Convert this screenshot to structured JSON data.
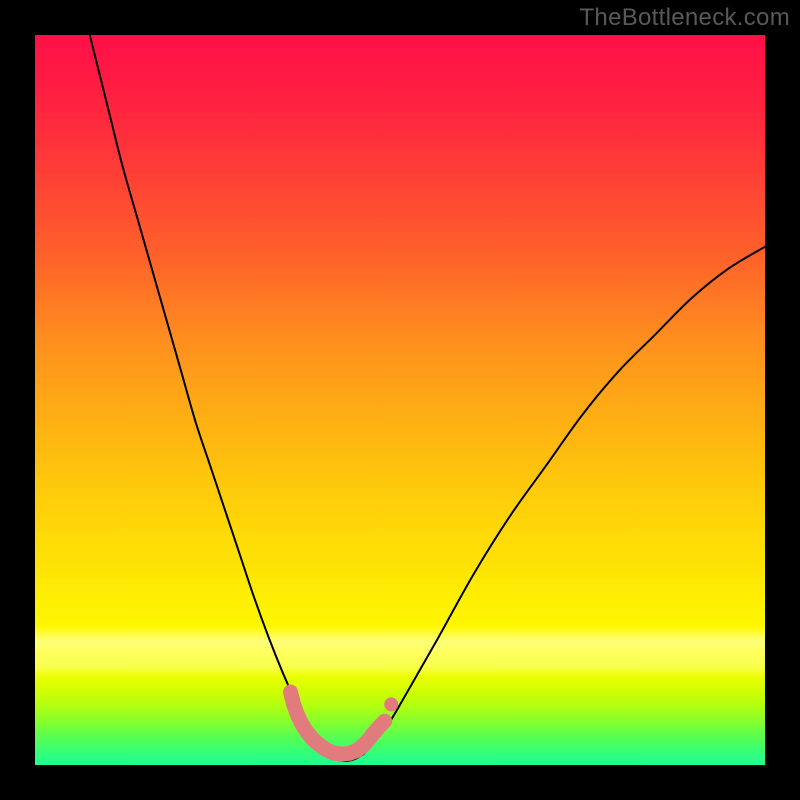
{
  "watermark": "TheBottleneck.com",
  "colors": {
    "background": "#000000",
    "curve": "#000000",
    "marker": "#e27b7d",
    "gradient_top": "#fe1047",
    "gradient_bottom": "#1efe93"
  },
  "chart_data": {
    "type": "line",
    "title": "",
    "xlabel": "",
    "ylabel": "",
    "xlim": [
      0,
      100
    ],
    "ylim": [
      0,
      100
    ],
    "y_orientation": "top_is_high_bottom_is_low",
    "notes": "Two curved lines forming a V/check-mark shape; bottom near x≈38-45 at y≈0-2; markers cluster near the valley. No tick labels visible.",
    "series": [
      {
        "name": "left-branch",
        "type": "curve",
        "x": [
          7.5,
          10,
          12,
          14,
          16,
          18,
          20,
          22,
          24,
          26,
          28,
          30,
          32,
          34,
          36,
          38,
          40
        ],
        "y": [
          100,
          90,
          82,
          75,
          68,
          61,
          54,
          47,
          41,
          35,
          29,
          23,
          17.5,
          12.5,
          8,
          4,
          1.5
        ]
      },
      {
        "name": "right-branch",
        "type": "curve",
        "x": [
          45,
          48,
          51,
          55,
          60,
          65,
          70,
          75,
          80,
          85,
          90,
          95,
          100
        ],
        "y": [
          1.5,
          5,
          10,
          17,
          26,
          34,
          41,
          48,
          54,
          59,
          64,
          68,
          71
        ]
      },
      {
        "name": "valley-floor",
        "type": "curve",
        "x": [
          40,
          41,
          42,
          43,
          44,
          45
        ],
        "y": [
          1.5,
          0.9,
          0.6,
          0.6,
          0.9,
          1.5
        ]
      },
      {
        "name": "marker-cluster",
        "type": "markers",
        "x": [
          35.0,
          35.4,
          35.9,
          36.5,
          37.2,
          38.0,
          38.9,
          39.9,
          41.0,
          42.1,
          43.1,
          44.1,
          45.0,
          45.8,
          46.5,
          47.2,
          47.9
        ],
        "y": [
          10.0,
          8.4,
          7.0,
          5.7,
          4.6,
          3.6,
          2.8,
          2.1,
          1.6,
          1.5,
          1.6,
          2.0,
          2.7,
          3.6,
          4.5,
          5.3,
          6.0
        ]
      }
    ],
    "gradient_background": {
      "description": "Vertical rainbow gradient mapping y (100→0) to color (red→green)",
      "stops_pct_to_color": [
        [
          0,
          "#fe1047"
        ],
        [
          12,
          "#fe2a3e"
        ],
        [
          24,
          "#fe4e31"
        ],
        [
          36,
          "#fe7824"
        ],
        [
          48,
          "#fea217"
        ],
        [
          60,
          "#fec40d"
        ],
        [
          72.5,
          "#fee205"
        ],
        [
          84,
          "#fefe00"
        ],
        [
          90,
          "#cffe03"
        ],
        [
          96,
          "#5cfe4f"
        ],
        [
          100,
          "#1efe93"
        ]
      ]
    },
    "bright_stripe": {
      "y_from": 19,
      "y_to": 12,
      "color_center": "#ffff5a"
    }
  }
}
